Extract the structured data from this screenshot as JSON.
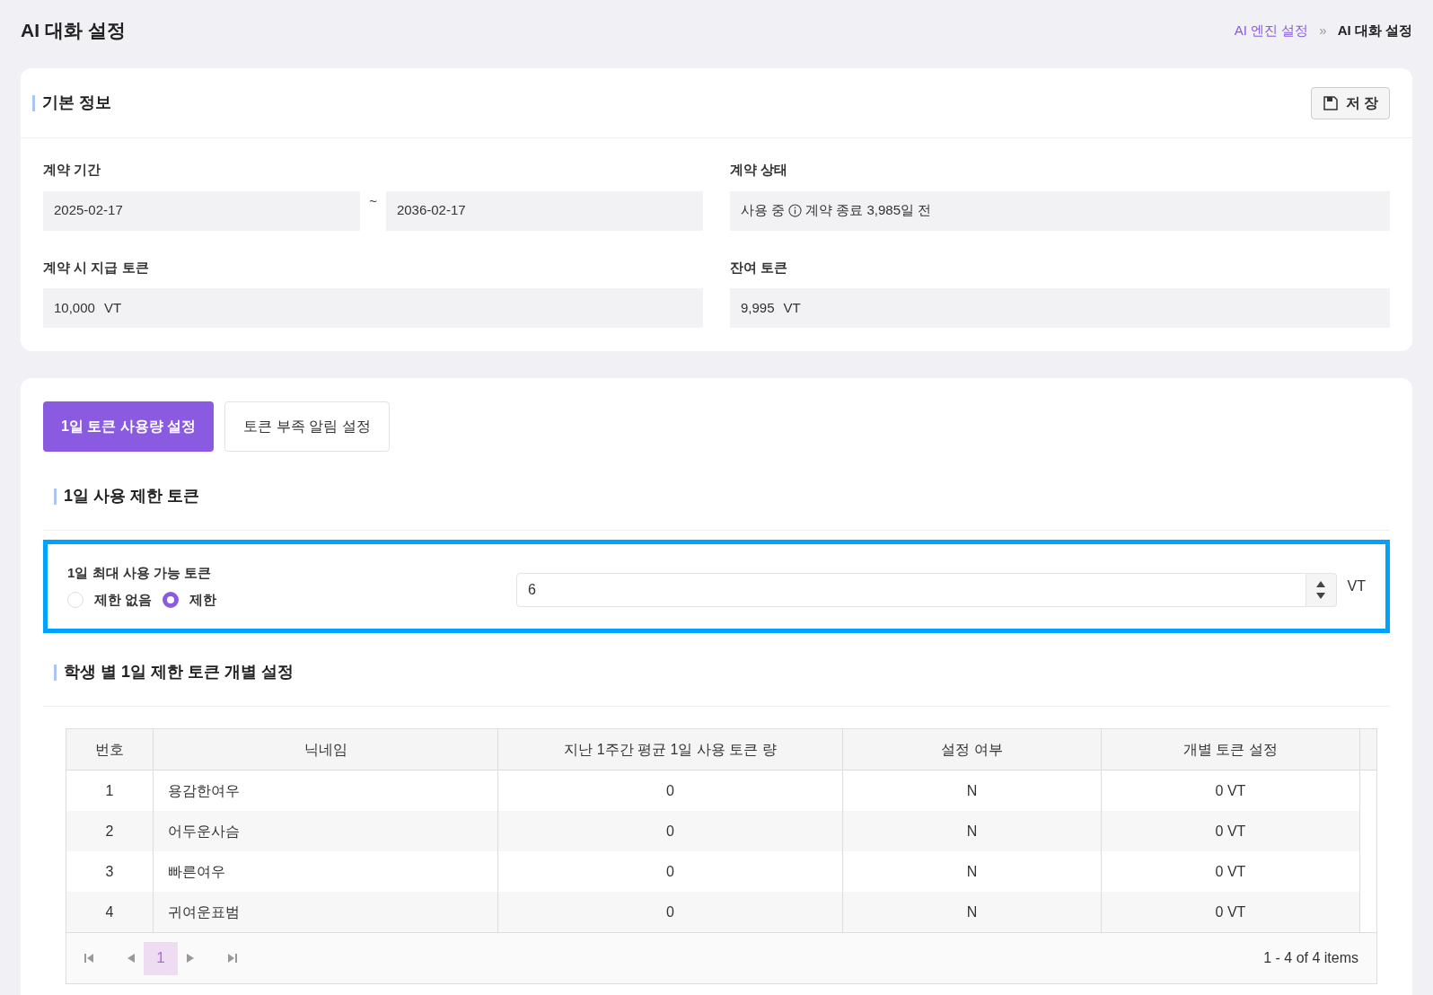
{
  "page_title": "AI 대화 설정",
  "breadcrumb": [
    {
      "label": "AI 엔진 설정",
      "kind": "link"
    },
    {
      "label": "»",
      "kind": "separator"
    },
    {
      "label": "AI 대화 설정",
      "kind": "current"
    }
  ],
  "basic_info": {
    "title": "기본 정보",
    "save_button": "저 장",
    "contract_period": {
      "label": "계약 기간",
      "start": "2025-02-17",
      "separator": "~",
      "end": "2036-02-17"
    },
    "contract_status": {
      "label": "계약 상태",
      "status": "사용 중",
      "note": "계약 종료 3,985일 전"
    },
    "granted_tokens": {
      "label": "계약 시 지급 토큰",
      "value": "10,000",
      "unit": "VT"
    },
    "remaining_tokens": {
      "label": "잔여 토큰",
      "value": "9,995",
      "unit": "VT"
    }
  },
  "tabs": [
    {
      "label": "1일 토큰 사용량 설정",
      "selected": true
    },
    {
      "label": "토큰 부족 알림 설정",
      "selected": false
    }
  ],
  "daily_limit": {
    "title": "1일 사용 제한 토큰",
    "highlighted": true,
    "field_label": "1일 최대 사용 가능 토큰",
    "radios": [
      {
        "label": "제한 없음",
        "selected": false
      },
      {
        "label": "제한",
        "selected": true
      }
    ],
    "value": "6",
    "unit": "VT"
  },
  "student_limits": {
    "title": "학생 별 1일 제한 토큰 개별 설정",
    "table": {
      "columns": [
        "번호",
        "닉네임",
        "지난 1주간 평균 1일 사용 토큰 량",
        "설정 여부",
        "개별 토큰 설정"
      ],
      "rows": [
        [
          "1",
          "용감한여우",
          "0",
          "N",
          "0 VT"
        ],
        [
          "2",
          "어두운사슴",
          "0",
          "N",
          "0 VT"
        ],
        [
          "3",
          "빠른여우",
          "0",
          "N",
          "0 VT"
        ],
        [
          "4",
          "귀여운표범",
          "0",
          "N",
          "0 VT"
        ]
      ]
    },
    "pagination": {
      "pages": [
        {
          "label": "1",
          "selected": true
        }
      ],
      "summary": "1 - 4 of 4 items"
    }
  }
}
